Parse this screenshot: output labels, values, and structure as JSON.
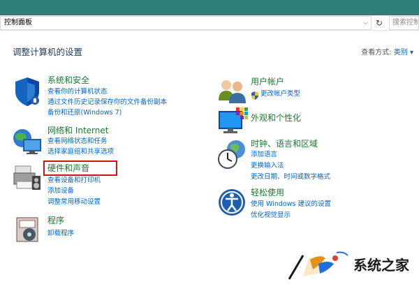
{
  "address_bar": {
    "path": "控制面板",
    "dropdown_glyph": "⌵",
    "refresh_glyph": "↻",
    "search_placeholder": "搜索控制面板"
  },
  "header": {
    "title": "调整计算机的设置",
    "view_by_label": "查看方式:",
    "view_by_value": "类别 ▾"
  },
  "categories": {
    "system_security": {
      "title": "系统和安全",
      "icon": "shield-icon",
      "links": [
        "查看你的计算机状态",
        "通过文件历史记录保存你的文件备份副本",
        "备份和还原(Windows 7)"
      ]
    },
    "network": {
      "title": "网络和 Internet",
      "icon": "network-icon",
      "links": [
        "查看网络状态和任务",
        "选择家庭组和共享选项"
      ]
    },
    "hardware_sound": {
      "title": "硬件和声音",
      "icon": "printer-icon",
      "links": [
        "查看设备和打印机",
        "添加设备",
        "调整常用移动设置"
      ]
    },
    "programs": {
      "title": "程序",
      "icon": "programs-icon",
      "links": [
        "卸载程序"
      ]
    },
    "user_accounts": {
      "title": "用户帐户",
      "icon": "users-icon",
      "links": [
        "更改帐户类型"
      ]
    },
    "appearance": {
      "title": "外观和个性化",
      "icon": "monitor-palette-icon",
      "links": []
    },
    "clock_region": {
      "title": "时钟、语言和区域",
      "icon": "clock-globe-icon",
      "links": [
        "添加语言",
        "更换输入法",
        "更改日期、时间或数字格式"
      ]
    },
    "ease_of_access": {
      "title": "轻松使用",
      "icon": "ease-of-access-icon",
      "links": [
        "使用 Windows 建议的设置",
        "优化视觉显示"
      ]
    }
  },
  "watermark": {
    "text": "系统之家"
  },
  "colors": {
    "titlebar": "#2f7f79",
    "category_title": "#1a7a2e",
    "link": "#0066cc",
    "highlight_box": "#d01414"
  }
}
